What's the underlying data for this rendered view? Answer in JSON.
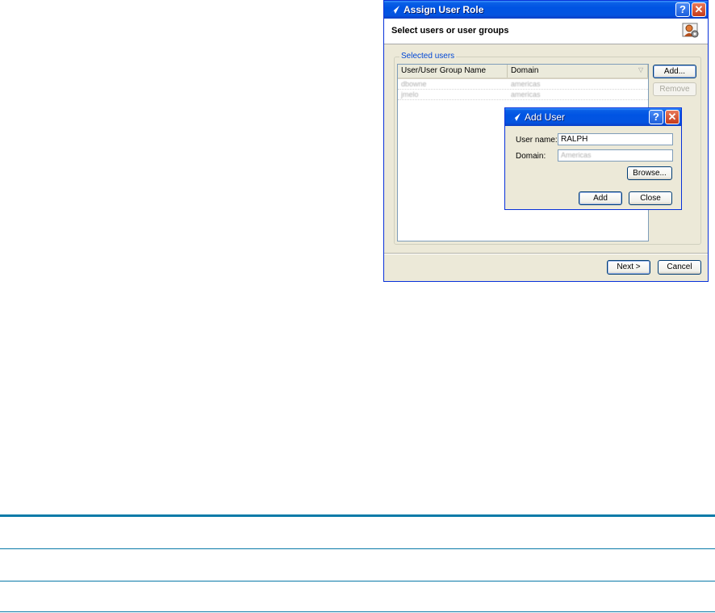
{
  "assign_dialog": {
    "title": "Assign User Role",
    "help_glyph": "?",
    "close_glyph": "✕",
    "header_title": "Select users or user groups",
    "header_icon": "user-role-icon",
    "group_label": "Selected users",
    "columns": [
      "User/User Group Name",
      "Domain"
    ],
    "rows": [
      {
        "name": "dbowne",
        "domain": "americas"
      },
      {
        "name": "jmelo",
        "domain": "americas"
      }
    ],
    "add_label": "Add...",
    "remove_label": "Remove",
    "next_label": "Next >",
    "cancel_label": "Cancel"
  },
  "add_user_dialog": {
    "title": "Add User",
    "help_glyph": "?",
    "close_glyph": "✕",
    "username_label": "User name:",
    "username_value": "RALPH",
    "domain_label": "Domain:",
    "domain_value": "Americas",
    "browse_label": "Browse...",
    "add_label": "Add",
    "close_label": "Close"
  },
  "colors": {
    "titlebar": "#0054e3",
    "window_face": "#ece9d8",
    "rule": "#0a7aa8"
  }
}
